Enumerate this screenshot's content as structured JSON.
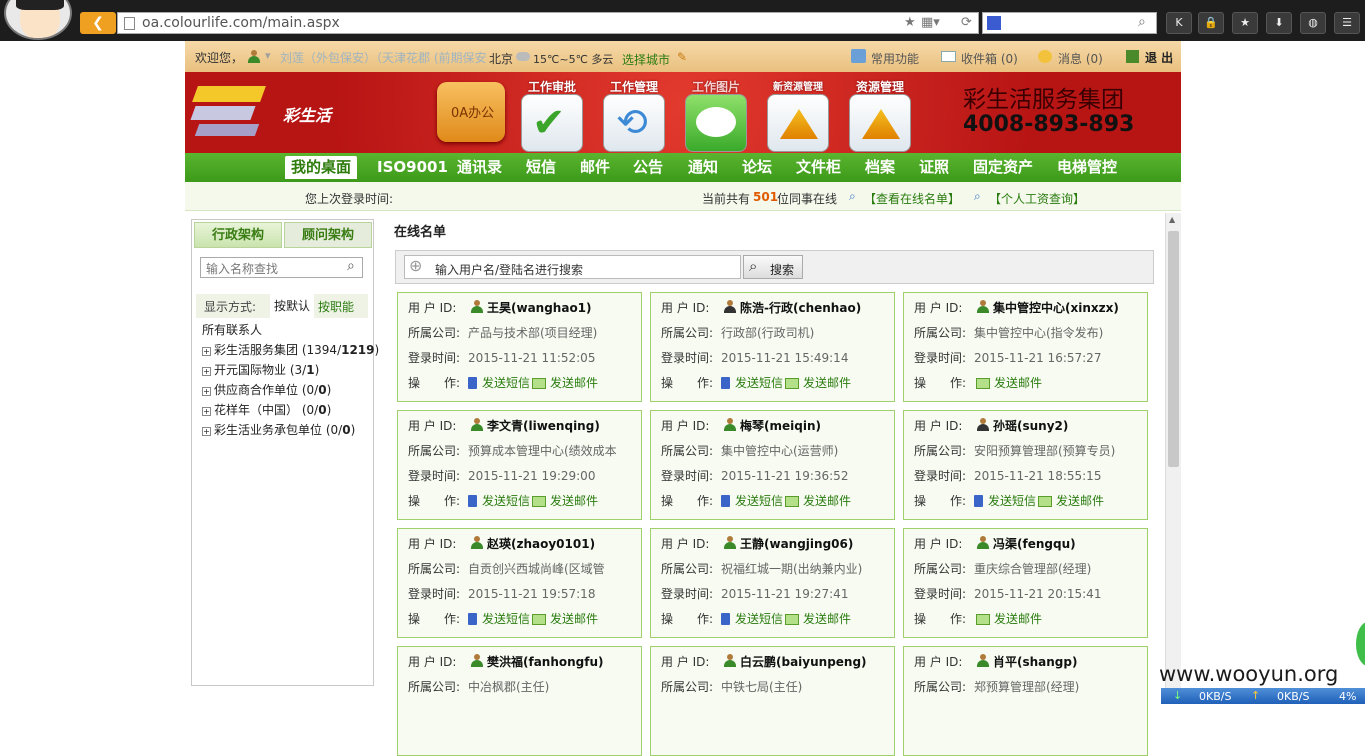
{
  "browser": {
    "url": "oa.colourlife.com/main.aspx"
  },
  "topbar": {
    "welcome": "欢迎您，",
    "user_text": "刘莲（外包保安）（天津花郡 (前期保安",
    "city": "北京",
    "weather": "15℃~5℃ 多云",
    "choose_city": "选择城市",
    "common": "常用功能",
    "inbox": "收件箱 (0)",
    "messages": "消息 (0)",
    "logout": "退 出"
  },
  "banner": {
    "logo_text": "彩生活",
    "oa_label": "0A办公",
    "tools": [
      {
        "label": "工作审批"
      },
      {
        "label": "工作管理"
      },
      {
        "label": "工作图片"
      },
      {
        "label": "新资源管理"
      },
      {
        "label": "资源管理"
      }
    ],
    "company": "彩生活服务集团",
    "phone": "4008-893-893"
  },
  "nav": [
    {
      "label": "我的桌面"
    },
    {
      "label": "ISO9001"
    },
    {
      "label": "通讯录"
    },
    {
      "label": "短信"
    },
    {
      "label": "邮件"
    },
    {
      "label": "公告"
    },
    {
      "label": "通知"
    },
    {
      "label": "论坛"
    },
    {
      "label": "文件柜"
    },
    {
      "label": "档案"
    },
    {
      "label": "证照"
    },
    {
      "label": "固定资产"
    },
    {
      "label": "电梯管控"
    }
  ],
  "sub": {
    "last_login": "您上次登录时间:",
    "online_prefix": "当前共有",
    "online_count": "501",
    "online_suffix": "位同事在线",
    "view_online": "【查看在线名单】",
    "salary": "【个人工资查询】"
  },
  "left": {
    "tab_admin": "行政架构",
    "tab_advisor": "顾问架构",
    "search_placeholder": "输入名称查找",
    "display_label": "显示方式:",
    "by_default": "按默认",
    "by_position": "按职能",
    "all_contacts": "所有联系人",
    "tree": [
      {
        "name": "彩生活服务集团",
        "count_pre": "(1394/",
        "count_bold": "1219",
        "count_post": ")"
      },
      {
        "name": "开元国际物业",
        "count_pre": "(3/",
        "count_bold": "1",
        "count_post": ")"
      },
      {
        "name": "供应商合作单位",
        "count_pre": "(0/",
        "count_bold": "0",
        "count_post": ")"
      },
      {
        "name": "花样年（中国）",
        "count_pre": "(0/",
        "count_bold": "0",
        "count_post": ")"
      },
      {
        "name": "彩生活业务承包单位",
        "count_pre": "(0/",
        "count_bold": "0",
        "count_post": ")"
      }
    ]
  },
  "main": {
    "title": "在线名单",
    "search_placeholder": "输入用户名/登陆名进行搜索",
    "search_button": "搜索",
    "labels": {
      "uid": "用 户 ID:",
      "company": "所属公司:",
      "login": "登录时间:",
      "op": "操　　作:",
      "sms": "发送短信",
      "mail": "发送邮件"
    },
    "cards": [
      {
        "name": "王昊(wanghao1)",
        "company": "产品与技术部(项目经理)",
        "time": "2015-11-21 11:52:05",
        "sms": true
      },
      {
        "name": "陈浩-行政(chenhao)",
        "company": "行政部(行政司机)",
        "time": "2015-11-21 15:49:14",
        "sms": true
      },
      {
        "name": "集中管控中心(xinxzx)",
        "company": "集中管控中心(指令发布)",
        "time": "2015-11-21 16:57:27",
        "sms": false
      },
      {
        "name": "李文青(liwenqing)",
        "company": "预算成本管理中心(绩效成本",
        "time": "2015-11-21 19:29:00",
        "sms": true
      },
      {
        "name": "梅琴(meiqin)",
        "company": "集中管控中心(运营师)",
        "time": "2015-11-21 19:36:52",
        "sms": true
      },
      {
        "name": "孙瑶(suny2)",
        "company": "安阳预算管理部(预算专员)",
        "time": "2015-11-21 18:55:15",
        "sms": true
      },
      {
        "name": "赵瑛(zhaoy0101)",
        "company": "自贡创兴西城尚峰(区域管",
        "time": "2015-11-21 19:57:18",
        "sms": true
      },
      {
        "name": "王静(wangjing06)",
        "company": "祝福红城一期(出纳兼内业)",
        "time": "2015-11-21 19:27:41",
        "sms": true
      },
      {
        "name": "冯渠(fengqu)",
        "company": "重庆综合管理部(经理)",
        "time": "2015-11-21 20:15:41",
        "sms": false
      },
      {
        "name": "樊洪福(fanhongfu)",
        "company": "中冶枫郡(主任)",
        "time": "",
        "sms": true
      },
      {
        "name": "白云鹏(baiyunpeng)",
        "company": "中铁七局(主任)",
        "time": "",
        "sms": true
      },
      {
        "name": "肖平(shangp)",
        "company": "郑预算管理部(经理)",
        "time": "",
        "sms": true
      }
    ]
  },
  "watermark": "www.wooyun.org",
  "netspeed": {
    "down": "0KB/S",
    "up": "0KB/S",
    "cpu": "4%"
  }
}
